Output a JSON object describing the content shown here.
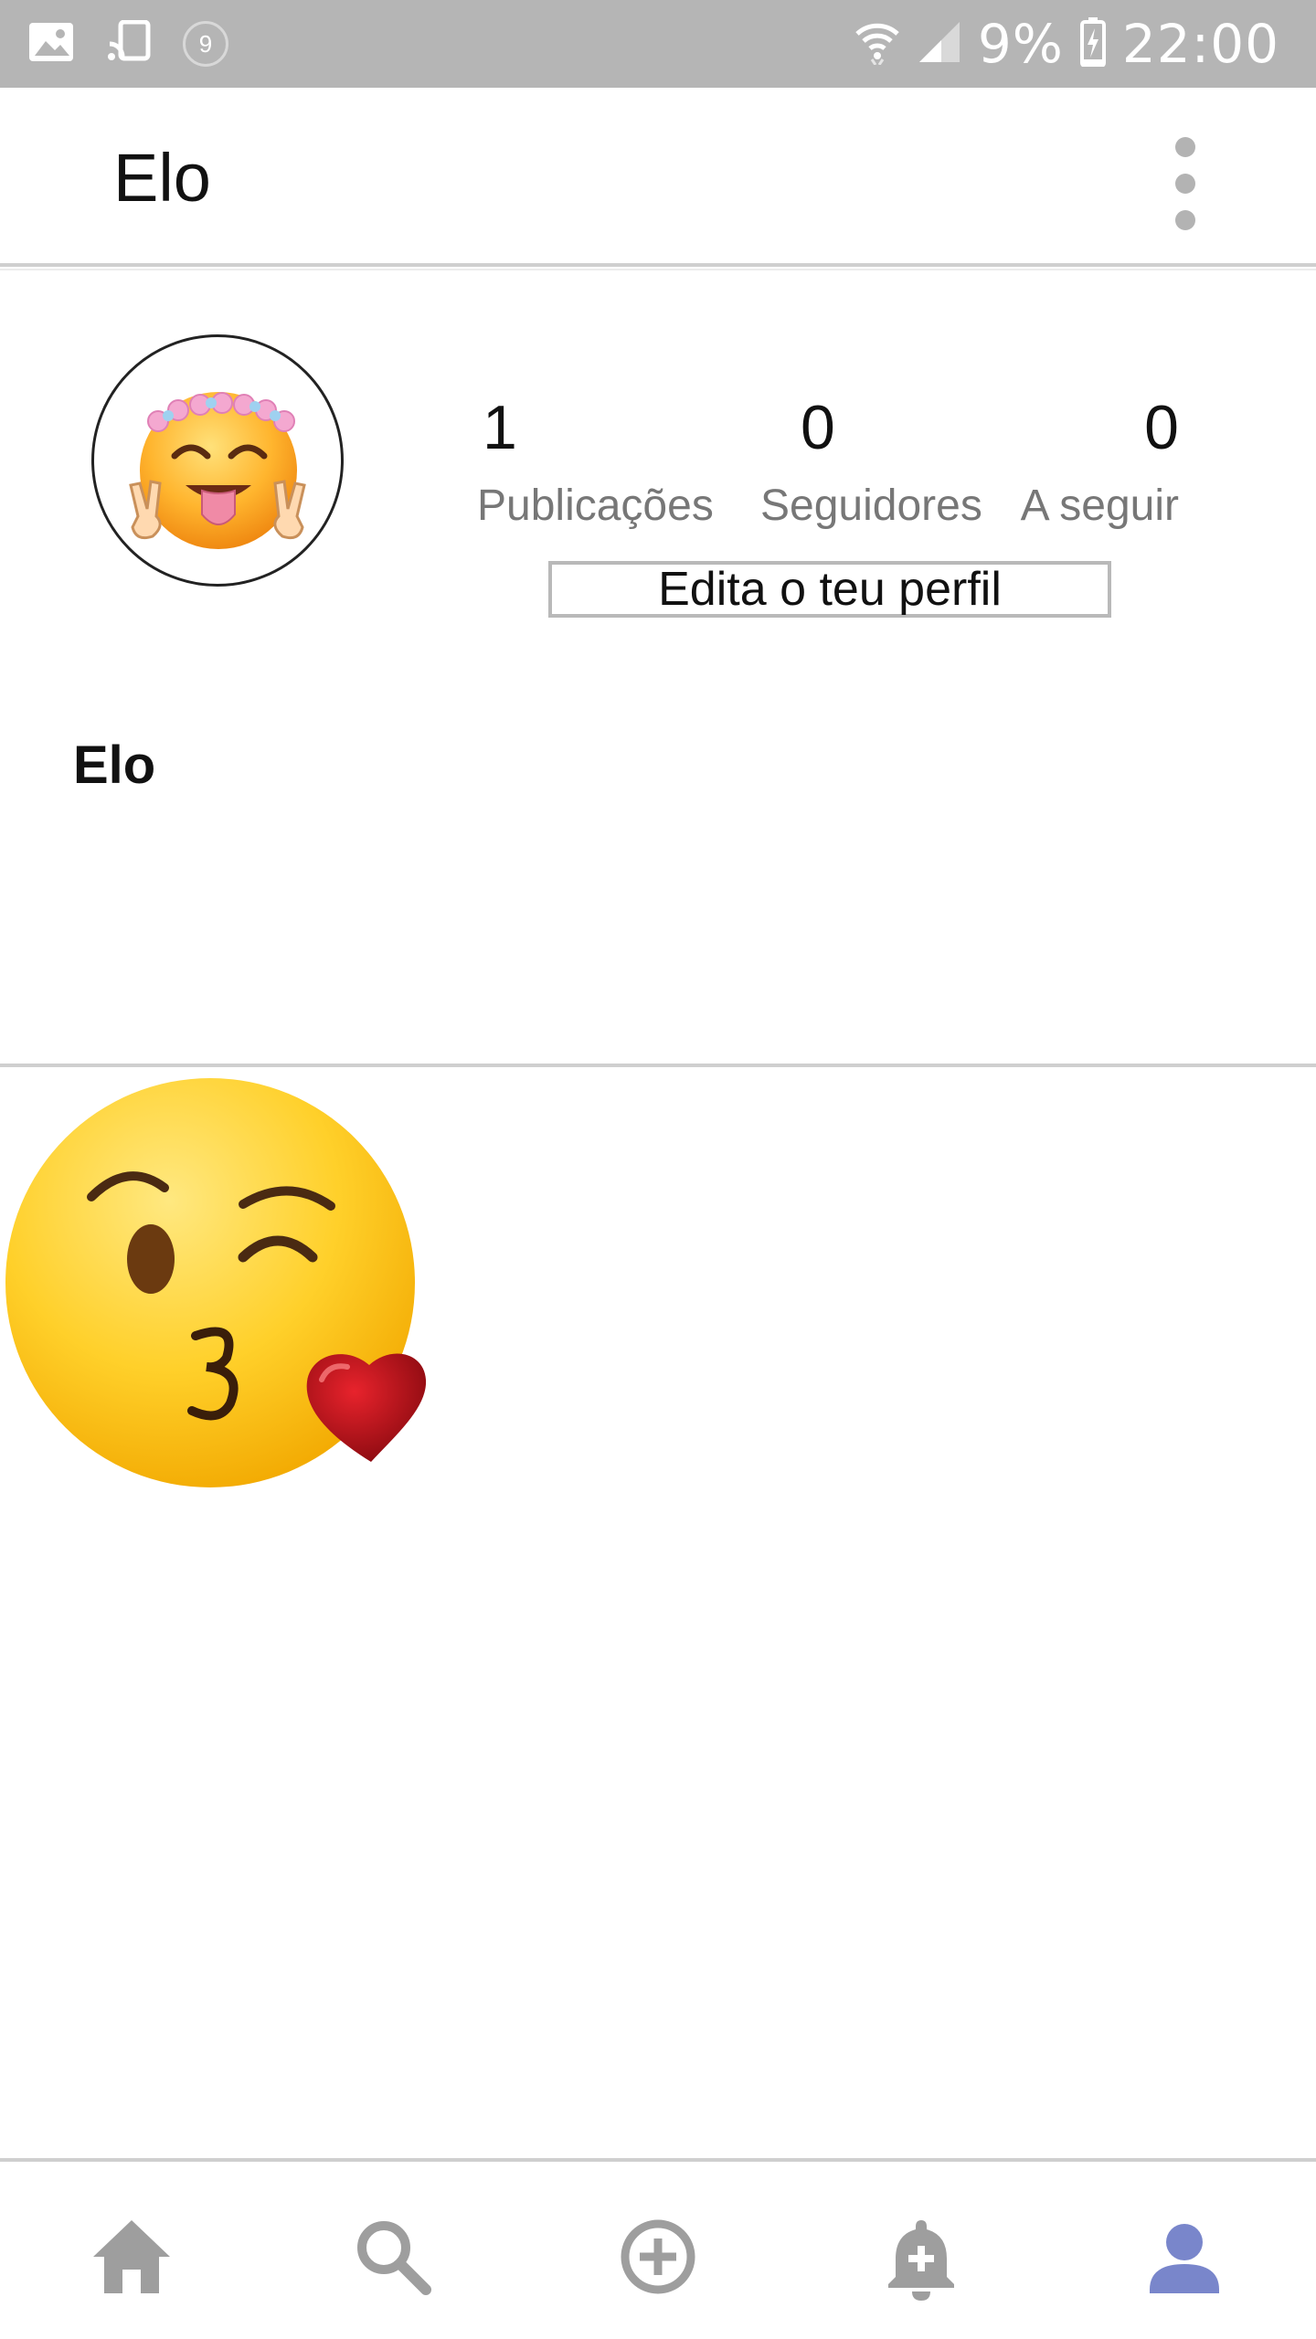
{
  "status_bar": {
    "notification_count": "9",
    "battery": "9%",
    "time": "22:00",
    "icons": [
      "image-icon",
      "cast-icon",
      "wifi-icon",
      "signal-icon",
      "battery-charging-icon"
    ]
  },
  "app_bar": {
    "title": "Elo",
    "menu_icon": "more-vert-icon"
  },
  "profile": {
    "avatar_icon": "emoji-flower-crown-peace-icon",
    "stats": [
      {
        "value": "1",
        "label": "Publicações"
      },
      {
        "value": "0",
        "label": "Seguidores"
      },
      {
        "value": "0",
        "label": "A seguir"
      }
    ],
    "edit_button": "Edita o teu perfil",
    "display_name": "Elo"
  },
  "posts": [
    {
      "icon": "kissing-heart-emoji-icon"
    }
  ],
  "bottom_nav": {
    "items": [
      "home-icon",
      "search-icon",
      "add-circle-icon",
      "notification-add-icon",
      "profile-icon"
    ],
    "active": "profile-icon",
    "colors": {
      "inactive": "#9e9e9e",
      "active": "#7986cb"
    }
  }
}
